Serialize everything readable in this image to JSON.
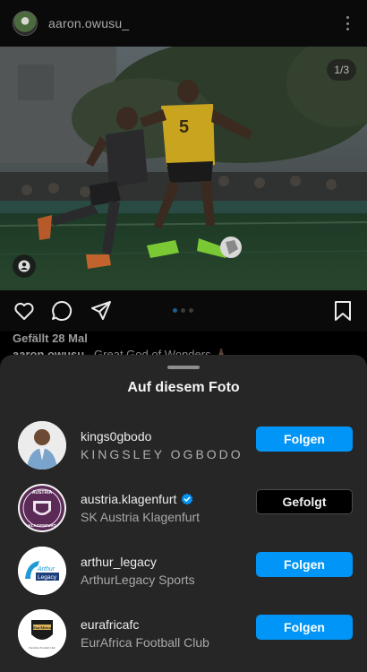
{
  "post": {
    "username": "aaron.owusu_",
    "image_counter": "1/3",
    "likes_text": "Gefällt 28 Mal",
    "caption_user": "aaron.owusu_",
    "caption_text": "Great God of Wonders 🙏🏿"
  },
  "icons": [
    "more-vertical-icon",
    "heart-icon",
    "comment-icon",
    "share-icon",
    "bookmark-icon",
    "user-tag-icon",
    "verified-badge-icon"
  ],
  "carousel": {
    "total": 3,
    "active_index": 0
  },
  "sheet": {
    "title": "Auf diesem Foto",
    "accounts": [
      {
        "username": "kings0gbodo",
        "full_name": "KINGSLEY OGBODO",
        "button": "Folgen",
        "following": false,
        "verified": false
      },
      {
        "username": "austria.klagenfurt",
        "full_name": "SK Austria Klagenfurt",
        "button": "Gefolgt",
        "following": true,
        "verified": true
      },
      {
        "username": "arthur_legacy",
        "full_name": "ArthurLegacy Sports",
        "button": "Folgen",
        "following": false,
        "verified": false
      },
      {
        "username": "eurafricafc",
        "full_name": "EurAfrica Football Club",
        "button": "Folgen",
        "following": false,
        "verified": false
      }
    ],
    "logo_text": {
      "austria_top": "AUSTRIA",
      "austria_bottom": "KLAGENFURT",
      "arthur_brand": "Arthur",
      "arthur_sub": "Legacy",
      "eurafrica_brand": "EurAfrica",
      "eurafrica_sub": "EurAfrica Football Club"
    }
  },
  "colors": {
    "accent": "#0095f6",
    "sheet_bg": "#262626",
    "background": "#000000",
    "verified": "#0095f6"
  }
}
